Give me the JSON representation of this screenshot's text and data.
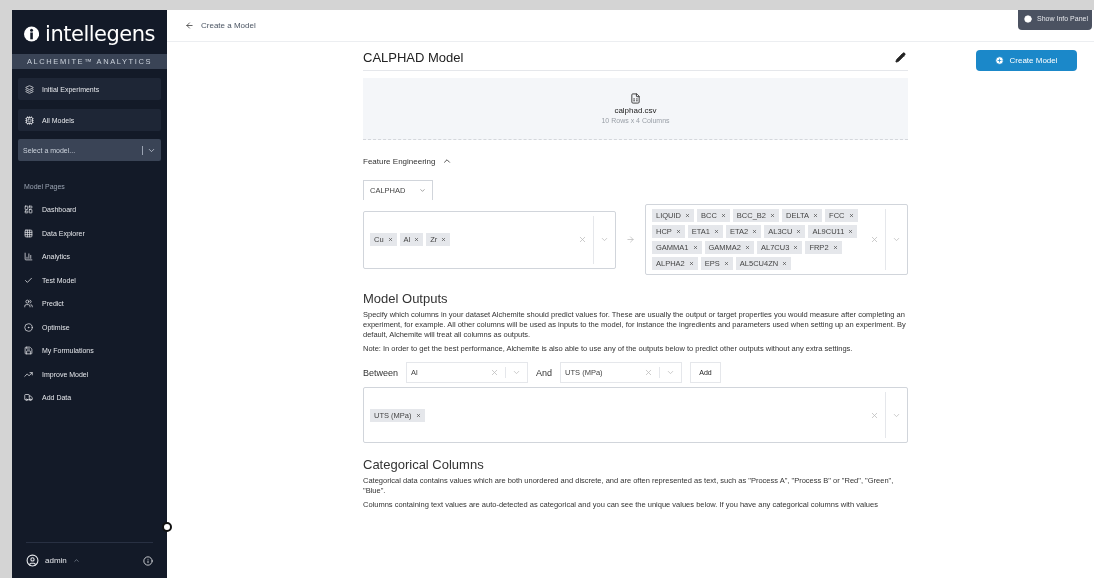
{
  "sidebar": {
    "brand": "intellegens",
    "tagline": "ALCHEMITE™ ANALYTICS",
    "top_items": [
      "Initial Experiments",
      "All Models"
    ],
    "model_select": {
      "placeholder": "Select a model..."
    },
    "section_label": "Model Pages",
    "items": [
      "Dashboard",
      "Data Explorer",
      "Analytics",
      "Test Model",
      "Predict",
      "Optimise",
      "My Formulations",
      "Improve Model",
      "Add Data"
    ],
    "user": "admin"
  },
  "header": {
    "back_label": "Create a Model",
    "info_button": "Show Info Panel"
  },
  "create_button": "Create Model",
  "model": {
    "title": "CALPHAD Model",
    "file_name": "calphad.csv",
    "file_meta": "10 Rows x 4 Columns"
  },
  "feature_engineering": {
    "label": "Feature Engineering",
    "expanded": true,
    "method": "CALPHAD",
    "inputs": [
      "Cu",
      "Al",
      "Zr"
    ],
    "outputs": [
      "LIQUID",
      "BCC",
      "BCC_B2",
      "DELTA",
      "FCC",
      "HCP",
      "ETA1",
      "ETA2",
      "AL3CU",
      "AL9CU11",
      "GAMMA1",
      "GAMMA2",
      "AL7CU3",
      "FRP2",
      "ALPHA2",
      "EPS",
      "AL5CU4ZN"
    ]
  },
  "model_outputs": {
    "title": "Model Outputs",
    "paragraphs": [
      "Specify which columns in your dataset Alchemite should predict values for. These are usually the output or target properties you would measure after completing an experiment, for example. All other columns will be used as inputs to the model, for instance the ingredients and parameters used when setting up an experiment. By default, Alchemite will treat all columns as outputs.",
      "Note: In order to get the best performance, Alchemite is also able to use any of the outputs below to predict other outputs without any extra settings."
    ],
    "between_label": "Between",
    "between_value": "Al",
    "and_label": "And",
    "and_value": "UTS (MPa)",
    "add_button": "Add",
    "selected": [
      "UTS (MPa)"
    ]
  },
  "categorical": {
    "title": "Categorical Columns",
    "paragraphs": [
      "Categorical data contains values which are both unordered and discrete, and are often represented as text, such as \"Process A\", \"Process B\" or \"Red\", \"Green\", \"Blue\".",
      "Columns containing text values are auto-detected as categorical and you can see the unique values below. If you have any categorical columns with values"
    ]
  }
}
